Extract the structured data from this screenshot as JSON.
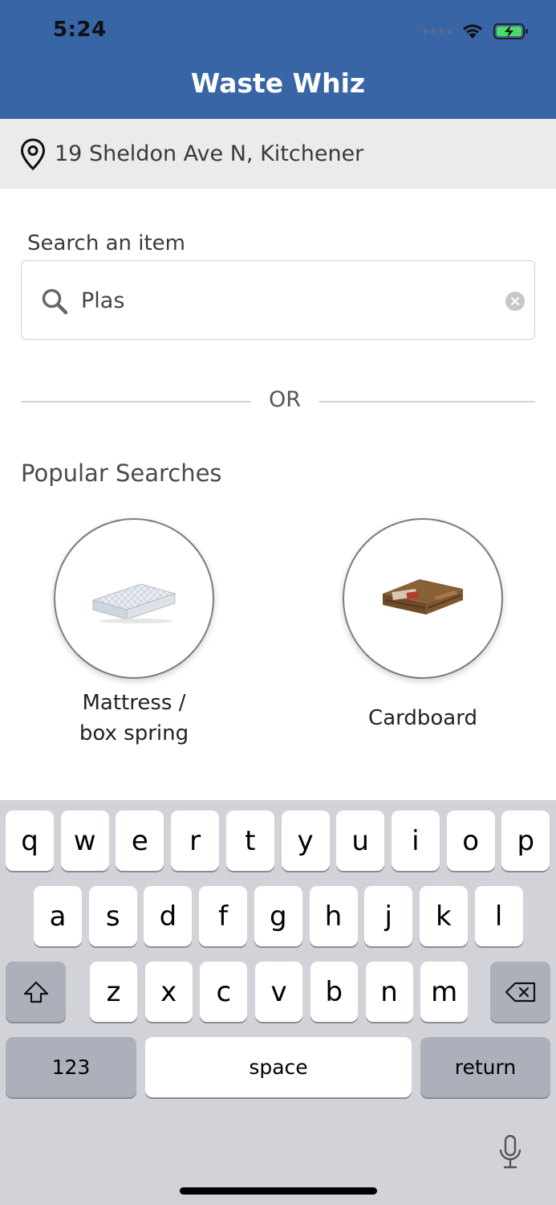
{
  "status_bar": {
    "time": "5:24",
    "icons": [
      "cellular-signal-icon",
      "wifi-icon",
      "battery-charging-icon"
    ]
  },
  "header": {
    "title": "Waste Whiz",
    "background": "#3865a6"
  },
  "location": {
    "icon": "location-pin-icon",
    "address": "19 Sheldon Ave N, Kitchener"
  },
  "search": {
    "label": "Search an item",
    "value": "Plas",
    "icon": "search-icon",
    "clear_icon": "clear-icon"
  },
  "divider": {
    "text": "OR"
  },
  "popular": {
    "title": "Popular Searches",
    "items": [
      {
        "label_line1": "Mattress /",
        "label_line2": "box spring",
        "icon": "mattress-image"
      },
      {
        "label": "Cardboard",
        "icon": "cardboard-image"
      }
    ]
  },
  "keyboard": {
    "row1": [
      "q",
      "w",
      "e",
      "r",
      "t",
      "y",
      "u",
      "i",
      "o",
      "p"
    ],
    "row2": [
      "a",
      "s",
      "d",
      "f",
      "g",
      "h",
      "j",
      "k",
      "l"
    ],
    "row3": [
      "z",
      "x",
      "c",
      "v",
      "b",
      "n",
      "m"
    ],
    "numbers_label": "123",
    "space_label": "space",
    "return_label": "return",
    "shift_icon": "shift-icon",
    "delete_icon": "backspace-icon",
    "mic_icon": "microphone-icon"
  }
}
